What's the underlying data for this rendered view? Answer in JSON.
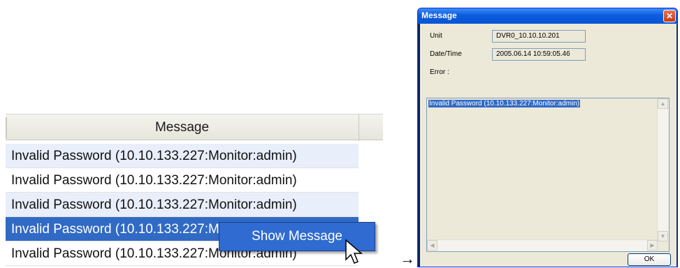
{
  "list": {
    "column_header": "Message",
    "rows": [
      "Invalid Password (10.10.133.227:Monitor:admin)",
      "Invalid Password (10.10.133.227:Monitor:admin)",
      "Invalid Password (10.10.133.227:Monitor:admin)",
      "Invalid Password (10.10.133.227:Monitor:admin)",
      "Invalid Password (10.10.133.227:Monitor:admin)"
    ],
    "selected_row_index": 3
  },
  "context_menu": {
    "item": "Show Message"
  },
  "arrow": "→",
  "dialog": {
    "title": "Message",
    "close_glyph": "✕",
    "unit_label": "Unit",
    "unit_value": "DVR0_10.10.10.201",
    "datetime_label": "Date/Time",
    "datetime_value": "2005.06.14 10:59:05.46",
    "error_label": "Error :",
    "error_text": "Invalid Password (10.10.133.227:Monitor:admin)",
    "ok_label": "OK"
  },
  "colors": {
    "selection": "#316ac5",
    "menu_highlight": "#2f6bd0",
    "titlebar": "#0b5ce0",
    "dialog_bg": "#ece9d8"
  }
}
